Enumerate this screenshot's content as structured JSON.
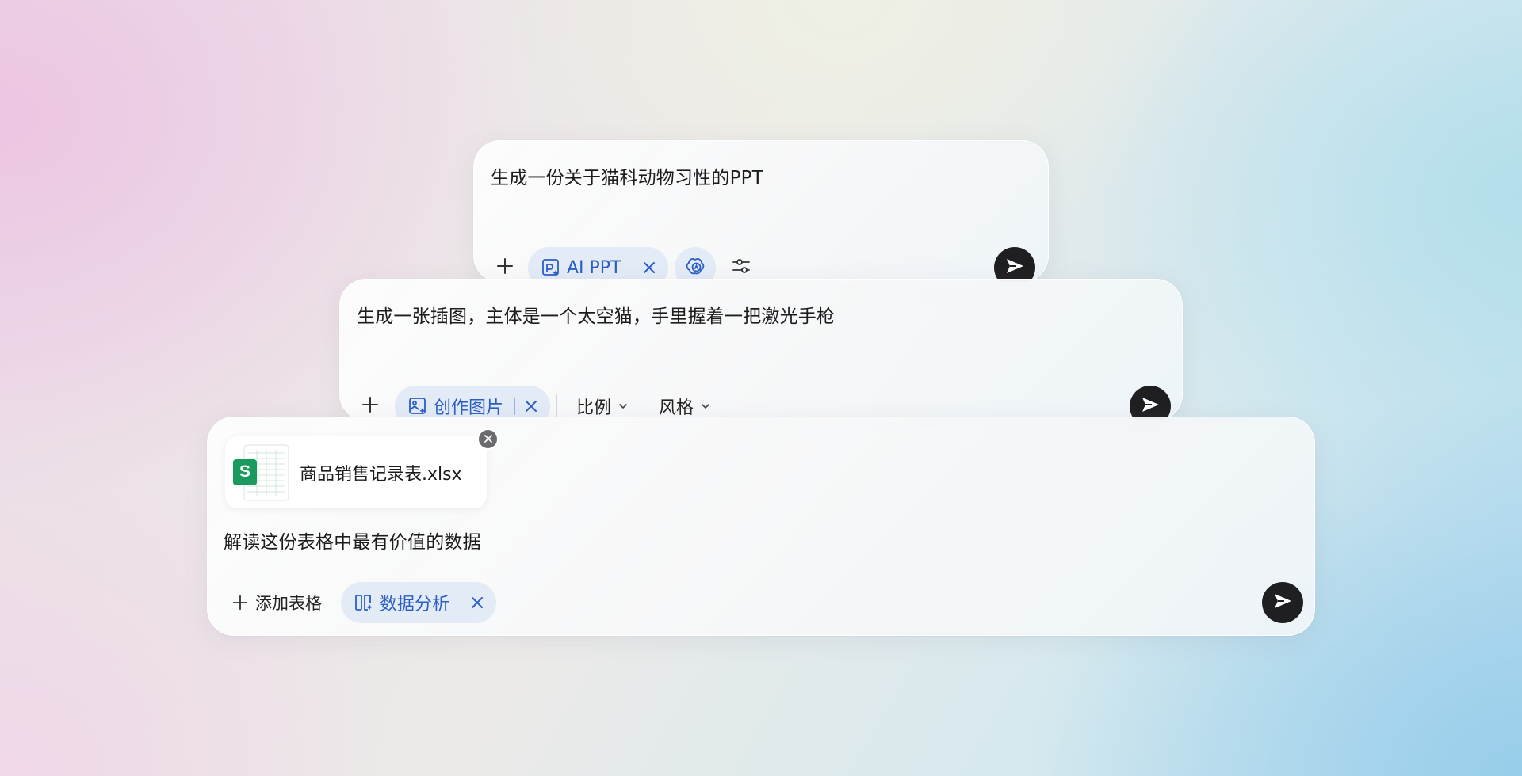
{
  "colors": {
    "chip_background": "#e3ebf7",
    "chip_text": "#2c5fc6",
    "send_button": "#1f1f21",
    "spreadsheet_badge": "#1a9a5c"
  },
  "ppt_card": {
    "prompt": "生成一份关于猫科动物习性的PPT",
    "chip_label": "AI PPT",
    "icons": [
      "plus-icon",
      "ppt-icon",
      "close-icon",
      "ai-model-icon",
      "settings-sliders-icon",
      "send-icon"
    ]
  },
  "image_card": {
    "prompt": "生成一张插图，主体是一个太空猫，手里握着一把激光手枪",
    "chip_label": "创作图片",
    "ratio_label": "比例",
    "style_label": "风格",
    "icons": [
      "plus-icon",
      "image-create-icon",
      "close-icon",
      "chevron-down-icon",
      "send-icon"
    ]
  },
  "data_card": {
    "file": {
      "name": "商品销售记录表.xlsx",
      "badge_letter": "S"
    },
    "prompt": "解读这份表格中最有价值的数据",
    "add_sheet_label": "添加表格",
    "chip_label": "数据分析",
    "icons": [
      "plus-icon",
      "data-analysis-icon",
      "close-icon",
      "send-icon"
    ]
  }
}
